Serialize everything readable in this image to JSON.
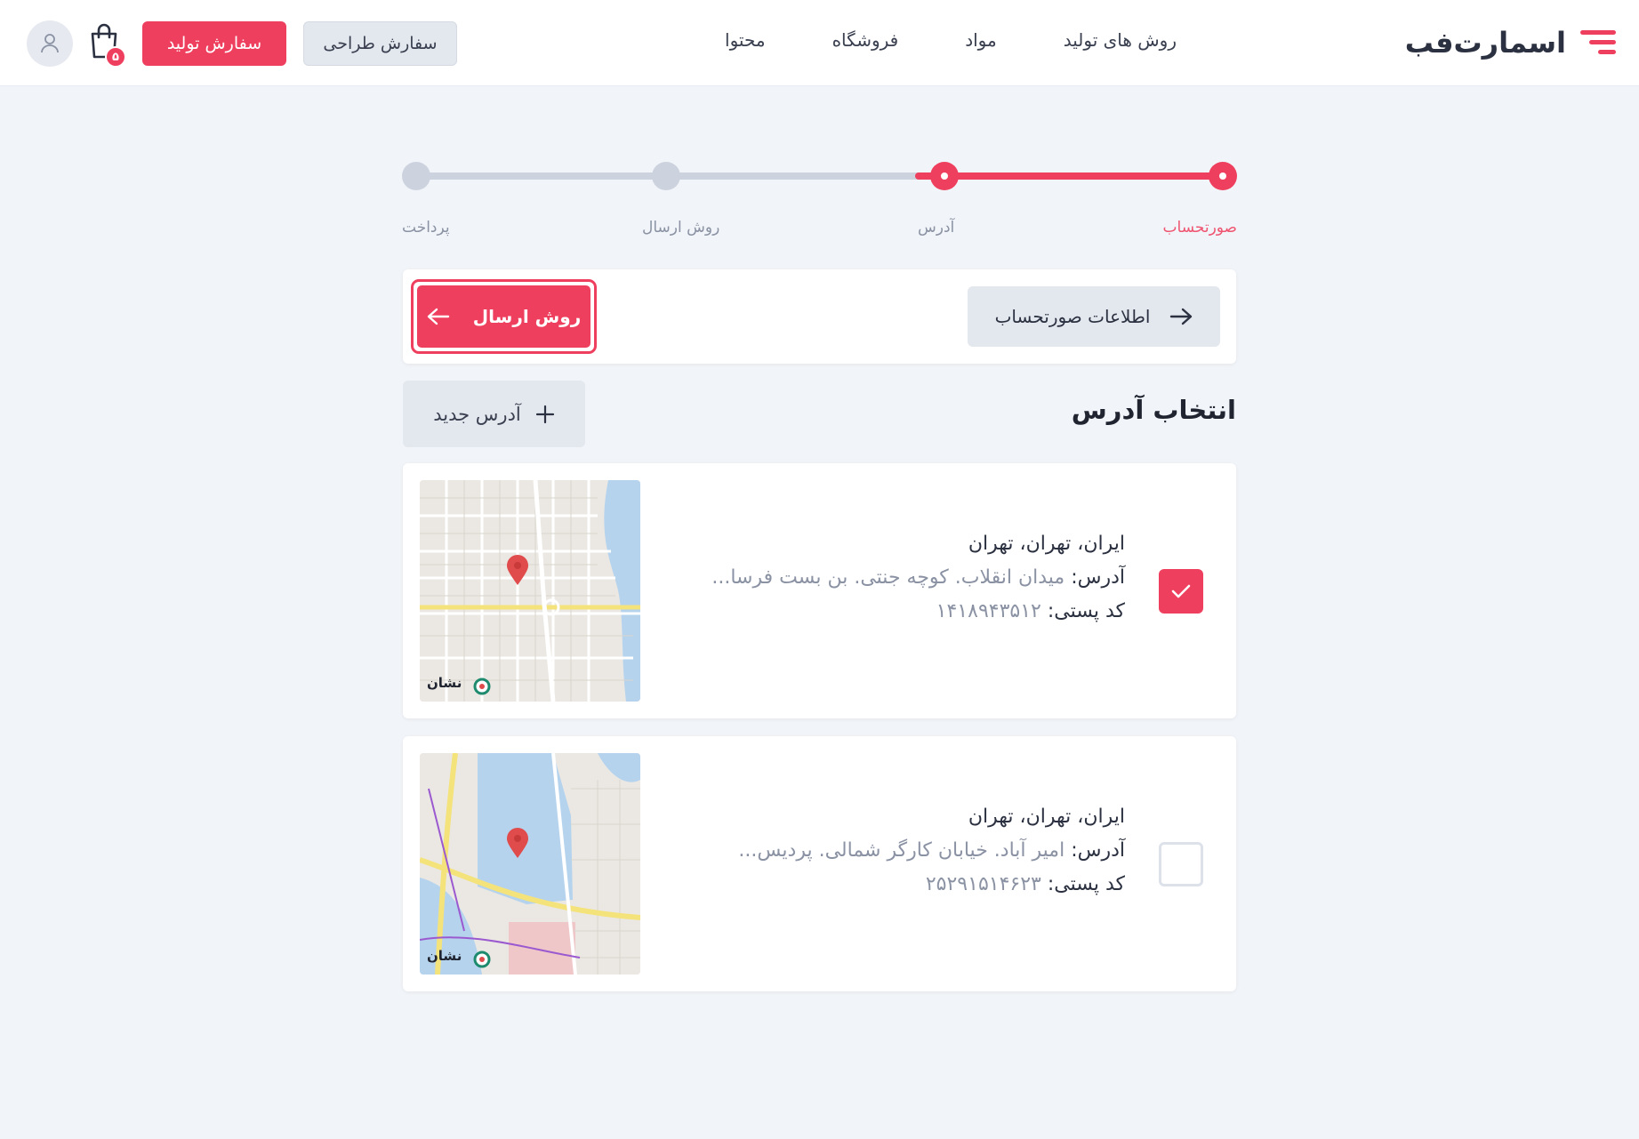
{
  "header": {
    "logo_text": "اسمارت‌فب",
    "nav": [
      "روش های تولید",
      "مواد",
      "فروشگاه",
      "محتوا"
    ],
    "design_order_label": "سفارش طراحی",
    "production_order_label": "سفارش تولید",
    "cart_count": "۵",
    "accent_color": "#ef3f5e"
  },
  "stepper": {
    "steps": [
      "صورتحساب",
      "آدرس",
      "روش ارسال",
      "پرداخت"
    ],
    "current_index": 1
  },
  "actions": {
    "back_label": "اطلاعات صورتحساب",
    "next_label": "روش ارسال"
  },
  "addresses": {
    "title": "انتخاب آدرس",
    "new_label": "آدرس جدید",
    "items": [
      {
        "city": "ایران، تهران، تهران",
        "address_label": "آدرس:",
        "address": "میدان انقلاب. کوچه جنتی. بن بست فرسا...",
        "postal_label": "کد پستی:",
        "postal": "۱۴۱۸۹۴۳۵۱۲",
        "selected": true
      },
      {
        "city": "ایران، تهران، تهران",
        "address_label": "آدرس:",
        "address": "امیر آباد. خیابان کارگر شمالی. پردیس...",
        "postal_label": "کد پستی:",
        "postal": "۲۵۲۹۱۵۱۴۶۲۳",
        "selected": false
      }
    ]
  },
  "map_brand": "نشان"
}
